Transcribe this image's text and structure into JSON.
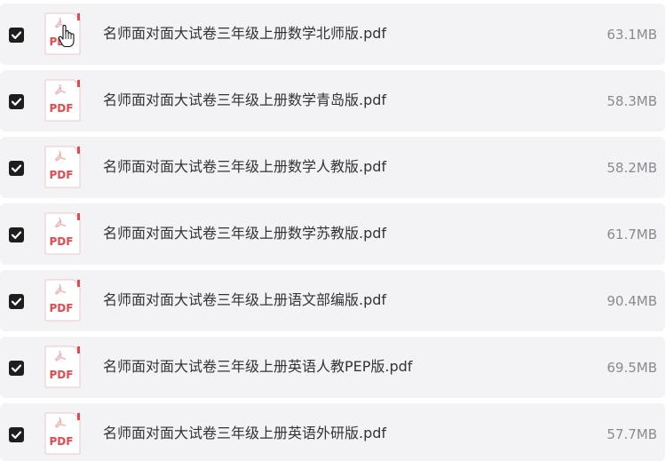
{
  "files": [
    {
      "name": "名师面对面大试卷三年级上册数学北师版.pdf",
      "size": "63.1MB",
      "checked": true,
      "icon": "pdf-file-icon",
      "icon_label": "PDF"
    },
    {
      "name": "名师面对面大试卷三年级上册数学青岛版.pdf",
      "size": "58.3MB",
      "checked": true,
      "icon": "pdf-file-icon",
      "icon_label": "PDF"
    },
    {
      "name": "名师面对面大试卷三年级上册数学人教版.pdf",
      "size": "58.2MB",
      "checked": true,
      "icon": "pdf-file-icon",
      "icon_label": "PDF"
    },
    {
      "name": "名师面对面大试卷三年级上册数学苏教版.pdf",
      "size": "61.7MB",
      "checked": true,
      "icon": "pdf-file-icon",
      "icon_label": "PDF"
    },
    {
      "name": "名师面对面大试卷三年级上册语文部编版.pdf",
      "size": "90.4MB",
      "checked": true,
      "icon": "pdf-file-icon",
      "icon_label": "PDF"
    },
    {
      "name": "名师面对面大试卷三年级上册英语人教PEP版.pdf",
      "size": "69.5MB",
      "checked": true,
      "icon": "pdf-file-icon",
      "icon_label": "PDF"
    },
    {
      "name": "名师面对面大试卷三年级上册英语外研版.pdf",
      "size": "57.7MB",
      "checked": true,
      "icon": "pdf-file-icon",
      "icon_label": "PDF"
    }
  ],
  "colors": {
    "row_background": "#f3f3f6",
    "checkbox": "#1e1e1e",
    "pdf_accent": "#e5484d",
    "filename_text": "#333333",
    "size_text": "#8a8a8f"
  },
  "cursor": "hand-pointer-icon"
}
